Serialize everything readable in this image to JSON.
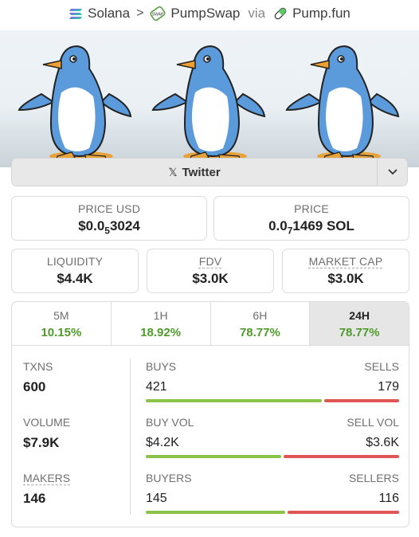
{
  "breadcrumb": {
    "chain": "Solana",
    "dex": "PumpSwap",
    "dex_badge": "SWAP",
    "via": "via",
    "launchpad": "Pump.fun"
  },
  "social": {
    "twitter_label": "Twitter",
    "x_glyph": "𝕏"
  },
  "price_usd": {
    "label": "PRICE USD",
    "prefix": "$0.0",
    "zeros": "5",
    "digits": "3024"
  },
  "price_native": {
    "label": "PRICE",
    "prefix": "0.0",
    "zeros": "7",
    "digits": "1469 SOL"
  },
  "liquidity": {
    "label": "LIQUIDITY",
    "value": "$4.4K"
  },
  "fdv": {
    "label": "FDV",
    "value": "$3.0K"
  },
  "market_cap": {
    "label": "MARKET CAP",
    "value": "$3.0K"
  },
  "tabs": [
    {
      "label": "5M",
      "value": "10.15%"
    },
    {
      "label": "1H",
      "value": "18.92%"
    },
    {
      "label": "6H",
      "value": "78.77%"
    },
    {
      "label": "24H",
      "value": "78.77%"
    }
  ],
  "active_tab": "24H",
  "stats": [
    {
      "label": "TXNS",
      "value": "600",
      "left_label": "BUYS",
      "right_label": "SELLS",
      "left_value": "421",
      "right_value": "179",
      "buy_fraction": 0.7017
    },
    {
      "label": "VOLUME",
      "value": "$7.9K",
      "left_label": "BUY VOL",
      "right_label": "SELL VOL",
      "left_value": "$4.2K",
      "right_value": "$3.6K",
      "buy_fraction": 0.5385
    },
    {
      "label": "MAKERS",
      "value": "146",
      "left_label": "BUYERS",
      "right_label": "SELLERS",
      "left_value": "145",
      "right_value": "116",
      "buy_fraction": 0.5556
    }
  ],
  "colors": {
    "positive": "#4f9a2a",
    "buy_bar": "#8bc34a",
    "sell_bar": "#e05555",
    "penguin_blue": "#5b9bdc"
  }
}
